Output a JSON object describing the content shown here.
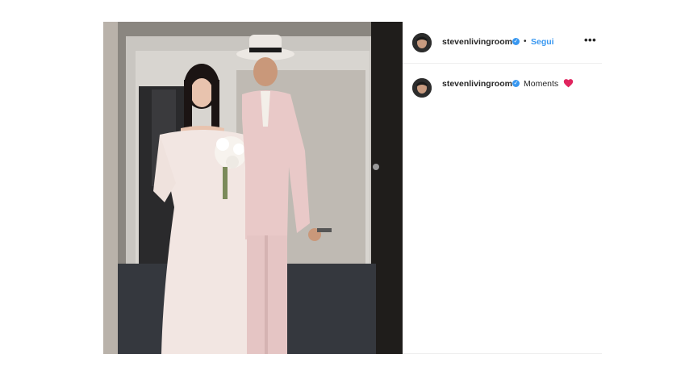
{
  "post": {
    "author": {
      "username": "stevenlivingroom",
      "verified_icon": "check-icon"
    },
    "follow_label": "Segui",
    "separator": "•",
    "more_label": "•••",
    "caption": {
      "text": "Moments",
      "emoji_icon": "red-heart-icon"
    },
    "photo_icon": "wedding-photo",
    "colors": {
      "link": "#3897f0",
      "text": "#262626",
      "heart": "#e0245e"
    }
  }
}
